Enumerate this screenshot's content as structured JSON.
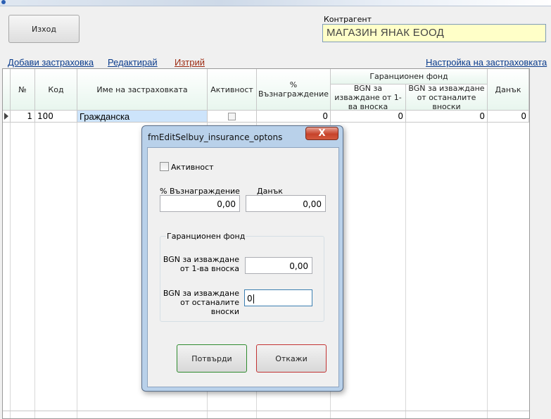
{
  "header": {
    "exit_label": "Изход",
    "kontragent_label": "Контрагент",
    "kontragent_value": "МАГАЗИН ЯНАК ЕООД"
  },
  "toolbar": {
    "add_label": "Добави застраховка",
    "edit_label": "Редактирай",
    "delete_label": "Изтрий",
    "settings_label": "Настройка на застраховката"
  },
  "grid": {
    "columns": {
      "num": "№",
      "code": "Код",
      "name": "Име на застраховката",
      "active": "Активност",
      "reward": "% Възнаграждение",
      "fund_group": "Гаранционен фонд",
      "fund_first": "BGN за изваждане от 1-ва вноска",
      "fund_rest": "BGN за изваждане от останалите вноски",
      "tax": "Данък"
    },
    "rows": [
      {
        "num": "1",
        "code": "100",
        "name": "Гражданска",
        "active": false,
        "reward": "0",
        "fund_first": "0",
        "fund_rest": "0",
        "tax": "0"
      }
    ]
  },
  "dialog": {
    "title": "fmEditSelbuy_insurance_optons",
    "close_label": "X",
    "active_label": "Активност",
    "reward_label": "% Възнаграждение",
    "reward_value": "0,00",
    "tax_label": "Данък",
    "tax_value": "0,00",
    "fund_title": "Гаранционен фонд",
    "fund_first_label_1": "BGN за изваждане",
    "fund_first_label_2": "от 1-ва вноска",
    "fund_first_value": "0,00",
    "fund_rest_label_1": "BGN за изваждане",
    "fund_rest_label_2": "от останалите",
    "fund_rest_label_3": "вноски",
    "fund_rest_value": "0",
    "confirm_label": "Потвърди",
    "cancel_label": "Откажи"
  },
  "colors": {
    "kontragent_bg": "#ffffc8",
    "link": "#0b3c8c",
    "delete_link": "#9c2b12",
    "selected_cell": "#cde4fb",
    "confirm_border": "#2e8b2e",
    "cancel_border": "#c23232",
    "dialog_frame": "#b9d1ea"
  }
}
